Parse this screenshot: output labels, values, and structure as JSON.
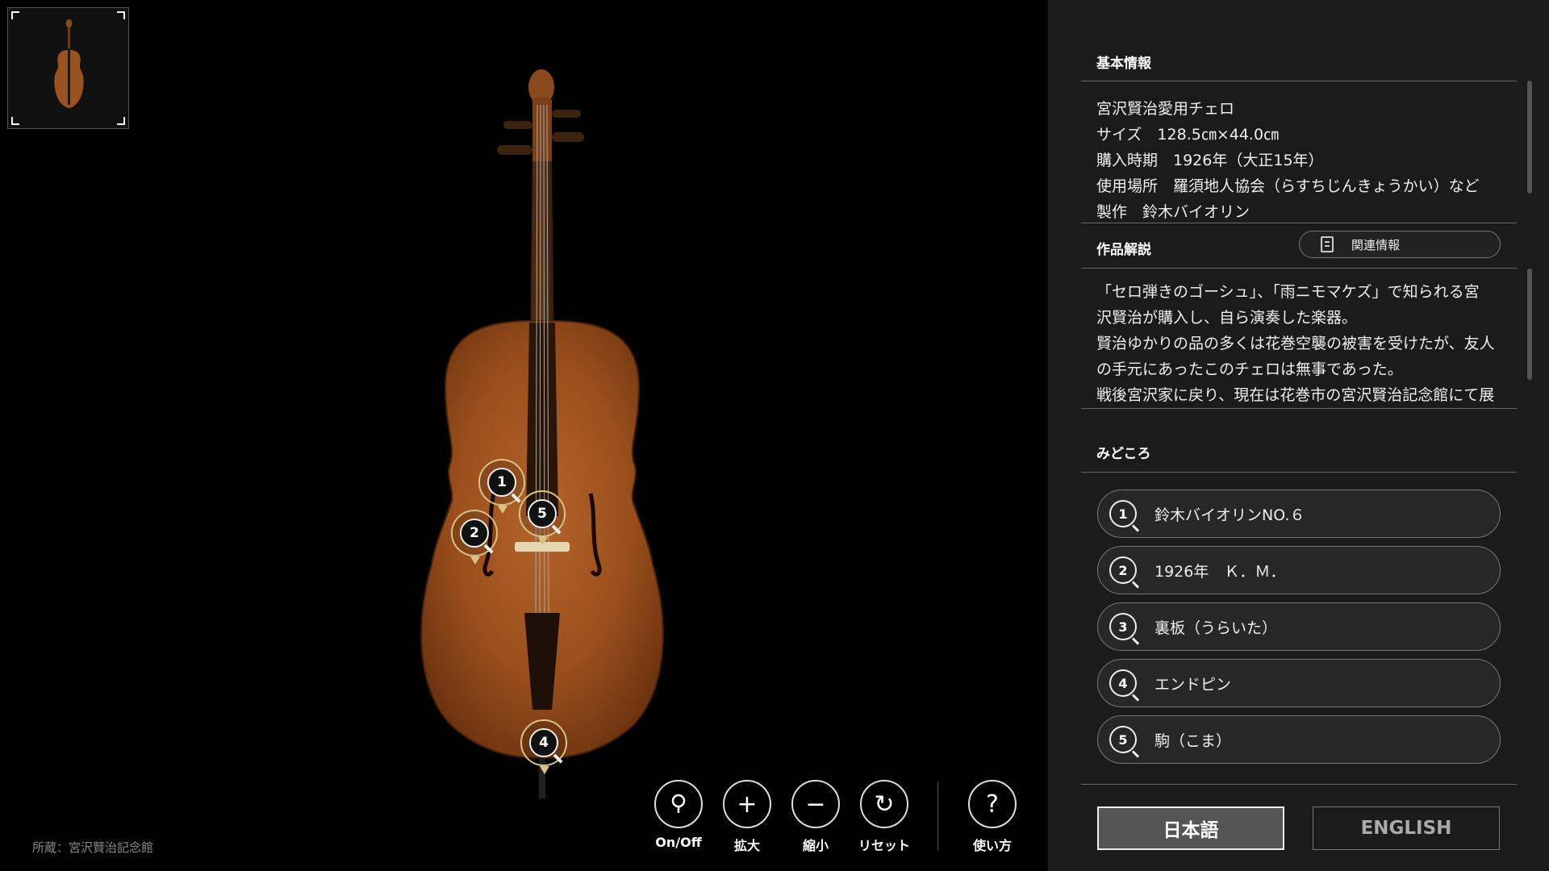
{
  "viewer": {
    "credit": "所蔵：宮沢賢治記念館",
    "hotspots": [
      "1",
      "2",
      "5",
      "4"
    ],
    "controls": [
      {
        "icon": "pin-icon",
        "label": "On/Off"
      },
      {
        "icon": "plus-icon",
        "label": "拡大"
      },
      {
        "icon": "minus-icon",
        "label": "縮小"
      },
      {
        "icon": "reset-icon",
        "label": "リセット"
      },
      {
        "icon": "help-icon",
        "label": "使い方"
      }
    ],
    "glyphs": {
      "plus": "+",
      "minus": "−",
      "reset": "↻",
      "help": "?"
    }
  },
  "panel": {
    "basic_title": "基本情報",
    "basic_lines": [
      "宮沢賢治愛用チェロ",
      "サイズ　128.5㎝×44.0㎝",
      "購入時期　1926年（大正15年）",
      "使用場所　羅須地人協会（らすちじんきょうかい）など",
      "製作　鈴木バイオリン"
    ],
    "desc_title": "作品解説",
    "related_label": "関連情報",
    "desc_lines": [
      "「セロ弾きのゴーシュ」、「雨ニモマケズ」で知られる宮",
      "沢賢治が購入し、自ら演奏した楽器。",
      "賢治ゆかりの品の多くは花巻空襲の被害を受けたが、友人",
      "の手元にあったこのチェロは無事であった。",
      "戦後宮沢家に戻り、現在は花巻市の宮沢賢治記念館にて展"
    ],
    "spots_title": "みどころ",
    "spots": [
      {
        "num": "1",
        "label": "鈴木バイオリンNO.６"
      },
      {
        "num": "2",
        "label": "1926年　Ｋ．Ｍ．"
      },
      {
        "num": "3",
        "label": "裏板（うらいた）"
      },
      {
        "num": "4",
        "label": "エンドピン"
      },
      {
        "num": "5",
        "label": "駒（こま）"
      }
    ],
    "lang_ja": "日本語",
    "lang_en": "ENGLISH"
  }
}
